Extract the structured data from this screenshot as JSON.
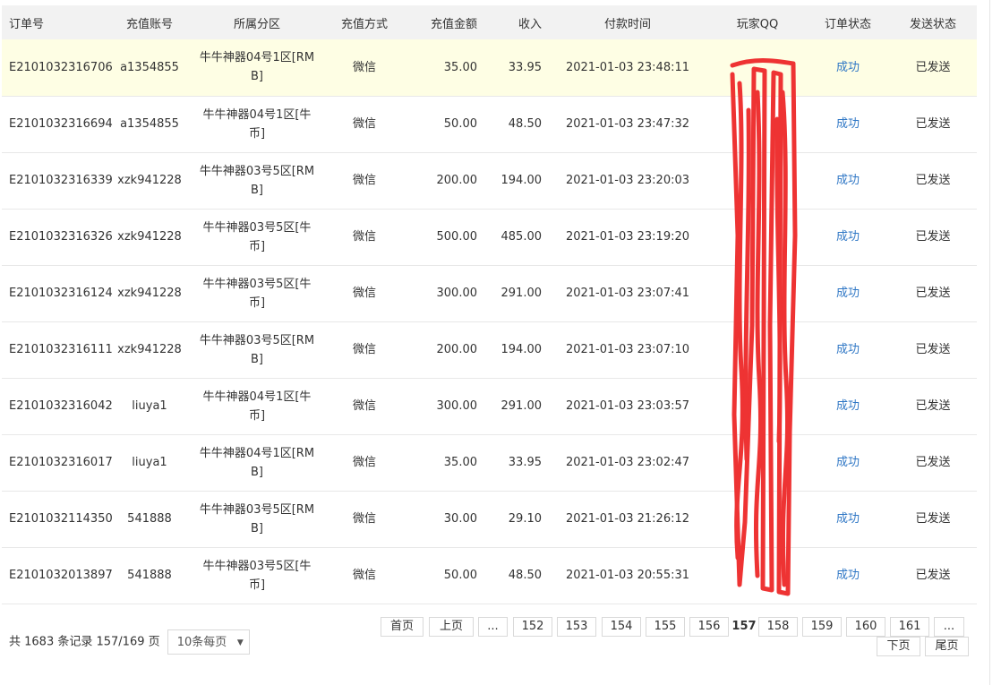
{
  "table": {
    "headers": [
      "订单号",
      "充值账号",
      "所属分区",
      "充值方式",
      "充值金额",
      "收入",
      "付款时间",
      "玩家QQ",
      "订单状态",
      "发送状态"
    ],
    "rows": [
      {
        "order": "E2101032316706",
        "account": "a1354855",
        "zone": "牛牛神器04号1区[RMB]",
        "method": "微信",
        "amount": "35.00",
        "income": "33.95",
        "time": "2021-01-03 23:48:11",
        "qq": "",
        "status": "成功",
        "send": "已发送"
      },
      {
        "order": "E2101032316694",
        "account": "a1354855",
        "zone": "牛牛神器04号1区[牛币]",
        "method": "微信",
        "amount": "50.00",
        "income": "48.50",
        "time": "2021-01-03 23:47:32",
        "qq": "",
        "status": "成功",
        "send": "已发送"
      },
      {
        "order": "E2101032316339",
        "account": "xzk941228",
        "zone": "牛牛神器03号5区[RMB]",
        "method": "微信",
        "amount": "200.00",
        "income": "194.00",
        "time": "2021-01-03 23:20:03",
        "qq": "",
        "status": "成功",
        "send": "已发送"
      },
      {
        "order": "E2101032316326",
        "account": "xzk941228",
        "zone": "牛牛神器03号5区[牛币]",
        "method": "微信",
        "amount": "500.00",
        "income": "485.00",
        "time": "2021-01-03 23:19:20",
        "qq": "",
        "status": "成功",
        "send": "已发送"
      },
      {
        "order": "E2101032316124",
        "account": "xzk941228",
        "zone": "牛牛神器03号5区[牛币]",
        "method": "微信",
        "amount": "300.00",
        "income": "291.00",
        "time": "2021-01-03 23:07:41",
        "qq": "",
        "status": "成功",
        "send": "已发送"
      },
      {
        "order": "E2101032316111",
        "account": "xzk941228",
        "zone": "牛牛神器03号5区[RMB]",
        "method": "微信",
        "amount": "200.00",
        "income": "194.00",
        "time": "2021-01-03 23:07:10",
        "qq": "",
        "status": "成功",
        "send": "已发送"
      },
      {
        "order": "E2101032316042",
        "account": "liuya1",
        "zone": "牛牛神器04号1区[牛币]",
        "method": "微信",
        "amount": "300.00",
        "income": "291.00",
        "time": "2021-01-03 23:03:57",
        "qq": "",
        "status": "成功",
        "send": "已发送"
      },
      {
        "order": "E2101032316017",
        "account": "liuya1",
        "zone": "牛牛神器04号1区[RMB]",
        "method": "微信",
        "amount": "35.00",
        "income": "33.95",
        "time": "2021-01-03 23:02:47",
        "qq": "",
        "status": "成功",
        "send": "已发送"
      },
      {
        "order": "E2101032114350",
        "account": "541888",
        "zone": "牛牛神器03号5区[RMB]",
        "method": "微信",
        "amount": "30.00",
        "income": "29.10",
        "time": "2021-01-03 21:26:12",
        "qq": "",
        "status": "成功",
        "send": "已发送"
      },
      {
        "order": "E2101032013897",
        "account": "541888",
        "zone": "牛牛神器03号5区[牛币]",
        "method": "微信",
        "amount": "50.00",
        "income": "48.50",
        "time": "2021-01-03 20:55:31",
        "qq": "",
        "status": "成功",
        "send": "已发送"
      }
    ]
  },
  "footer": {
    "summary": "共 1683 条记录 157/169 页",
    "page_size": "10条每页"
  },
  "pager": {
    "first": "首页",
    "prev": "上页",
    "ellipsis1": "...",
    "p152": "152",
    "p153": "153",
    "p154": "154",
    "p155": "155",
    "p156": "156",
    "current": "157",
    "p158": "158",
    "p159": "159",
    "p160": "160",
    "p161": "161",
    "ellipsis2": "...",
    "next": "下页",
    "last": "尾页"
  },
  "colors": {
    "header_bg": "#f2f2f2",
    "highlight_row_bg": "#fefee4",
    "status_link": "#2f77c5",
    "redaction": "#ee3333"
  }
}
